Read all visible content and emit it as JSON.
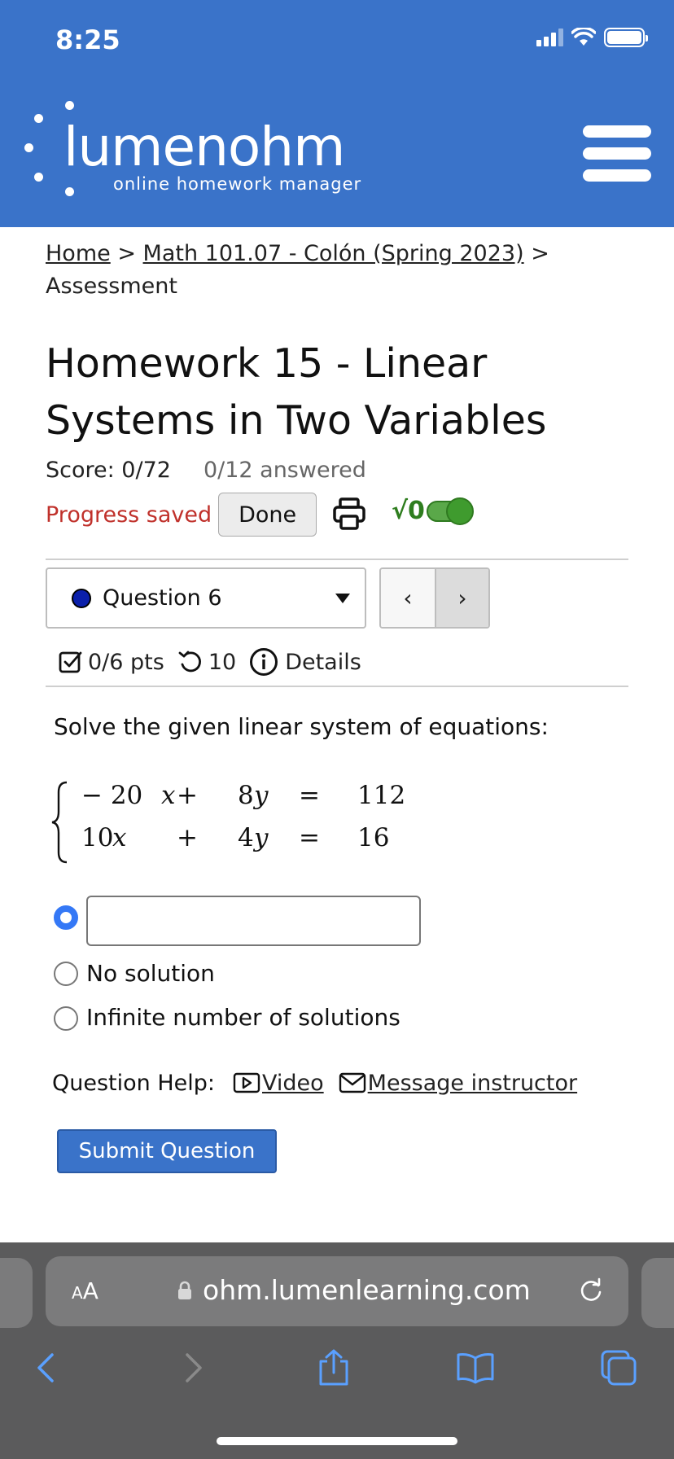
{
  "status_bar": {
    "time": "8:25"
  },
  "header": {
    "logo_text": "lumenohm",
    "logo_subtitle": "online homework manager",
    "brand_color": "#3a73c9"
  },
  "breadcrumb": {
    "home": "Home",
    "sep1": " > ",
    "course": "Math 101.07 - Colón (Spring 2023)",
    "sep2": " > ",
    "current": "Assessment"
  },
  "assessment": {
    "title": "Homework 15 - Linear Systems in Two Variables",
    "score": "Score: 0/72",
    "answered": "0/12 answered",
    "progress_status": "Progress saved",
    "done_label": "Done",
    "math_toggle_label": "√0"
  },
  "question_nav": {
    "selected": "Question 6",
    "prev": "‹",
    "next": "›"
  },
  "question_meta": {
    "points": "0/6 pts",
    "attempts": "10",
    "details": "Details"
  },
  "question": {
    "prompt": "Solve the given linear system of equations:",
    "equations": [
      {
        "a": "− 20",
        "x": "x",
        "op": "+",
        "b": "8",
        "y": "y",
        "eq": "=",
        "c": "112"
      },
      {
        "a": "10",
        "x": "x",
        "op": "+",
        "b": "4",
        "y": "y",
        "eq": "=",
        "c": "16"
      }
    ],
    "answer_value": "",
    "options": [
      "No solution",
      "Infinite number of solutions"
    ]
  },
  "help": {
    "label": "Question Help:",
    "video": "Video",
    "message": "Message instructor"
  },
  "submit_label": "Submit Question",
  "browser": {
    "text_size": "AA",
    "url": "ohm.lumenlearning.com"
  }
}
